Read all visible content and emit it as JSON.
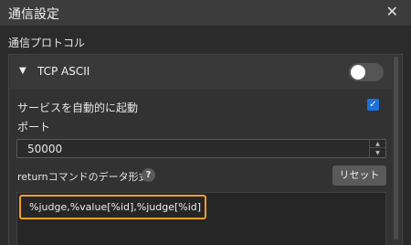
{
  "window": {
    "title": "通信設定",
    "close_glyph": "✕"
  },
  "section": {
    "label": "通信プロトコル"
  },
  "group": {
    "title": "TCP ASCII",
    "chevron": "▼",
    "enabled": false
  },
  "autostart": {
    "label": "サービスを自動的に起動",
    "checked": true,
    "check_glyph": "✓"
  },
  "port": {
    "label": "ポート",
    "value": "50000",
    "up_glyph": "▲",
    "down_glyph": "▼"
  },
  "format": {
    "label": "returnコマンドのデータ形式",
    "help_glyph": "?",
    "reset_label": "リセット",
    "value": "%judge,%value[%id],%judge[%id]"
  },
  "colors": {
    "accent": "#1e6fd9",
    "highlight": "#f0a020",
    "background": "#2b2b2b"
  }
}
